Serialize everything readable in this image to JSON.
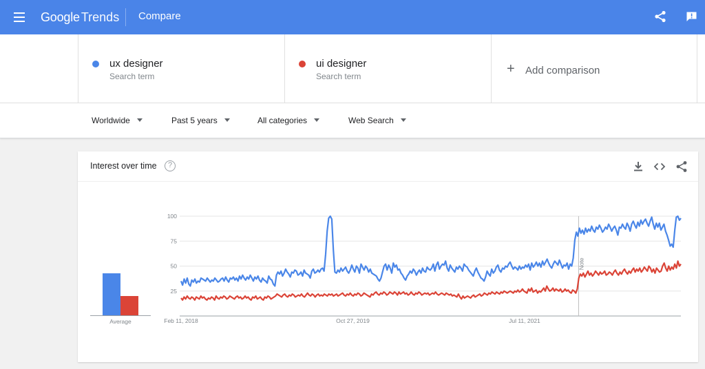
{
  "header": {
    "logo_google": "Google",
    "logo_trends": "Trends",
    "title": "Compare",
    "menu_icon": "hamburger-menu-icon",
    "share_icon": "share-icon",
    "feedback_icon": "feedback-icon"
  },
  "terms": [
    {
      "name": "ux designer",
      "sub": "Search term",
      "color": "#4a86e8"
    },
    {
      "name": "ui designer",
      "sub": "Search term",
      "color": "#db4437"
    }
  ],
  "add_comparison": {
    "icon": "+",
    "label": "Add comparison"
  },
  "filters": [
    "Worldwide",
    "Past 5 years",
    "All categories",
    "Web Search"
  ],
  "card": {
    "title": "Interest over time",
    "help_icon": "?",
    "average_label": "Average",
    "note_label": "Note"
  },
  "colors": {
    "header": "#4a84e8",
    "series_ux": "#4a86e8",
    "series_ui": "#db4437"
  },
  "chart_data": {
    "type": "line",
    "ylim": [
      0,
      100
    ],
    "y_ticks": [
      25,
      50,
      75,
      100
    ],
    "x_tick_labels": [
      "Feb 11, 2018",
      "Oct 27, 2019",
      "Jul 11, 2021"
    ],
    "x_start": "2018-02-11",
    "x_end": "2023-01-29",
    "note_date": "2022-01-23",
    "averages": {
      "ux designer": 53,
      "ui designer": 24
    },
    "series": [
      {
        "name": "ux designer",
        "color": "#4a86e8",
        "values": [
          35,
          31,
          37,
          33,
          38,
          32,
          30,
          36,
          34,
          37,
          33,
          35,
          34,
          38,
          37,
          36,
          35,
          38,
          36,
          34,
          36,
          35,
          38,
          36,
          34,
          35,
          37,
          38,
          35,
          39,
          36,
          34,
          38,
          37,
          39,
          36,
          38,
          35,
          40,
          37,
          41,
          38,
          36,
          39,
          37,
          41,
          38,
          35,
          39,
          37,
          40,
          36,
          34,
          38,
          36,
          35,
          33,
          40,
          37,
          36,
          32,
          30,
          41,
          44,
          42,
          45,
          40,
          43,
          47,
          44,
          42,
          39,
          44,
          43,
          46,
          45,
          41,
          42,
          44,
          40,
          46,
          43,
          42,
          41,
          38,
          45,
          47,
          43,
          44,
          46,
          44,
          47,
          48,
          45,
          62,
          85,
          98,
          100,
          97,
          66,
          44,
          43,
          46,
          44,
          48,
          45,
          47,
          49,
          45,
          43,
          46,
          51,
          47,
          44,
          50,
          48,
          43,
          52,
          49,
          46,
          50,
          48,
          44,
          47,
          43,
          42,
          41,
          40,
          37,
          35,
          38,
          44,
          50,
          52,
          46,
          51,
          48,
          43,
          53,
          49,
          51,
          46,
          47,
          43,
          41,
          38,
          36,
          40,
          42,
          45,
          43,
          47,
          45,
          41,
          44,
          46,
          43,
          48,
          45,
          44,
          49,
          47,
          46,
          48,
          52,
          45,
          51,
          54,
          47,
          50,
          52,
          51,
          55,
          48,
          45,
          51,
          48,
          46,
          44,
          49,
          47,
          50,
          48,
          45,
          52,
          50,
          49,
          46,
          44,
          42,
          40,
          45,
          48,
          44,
          41,
          38,
          37,
          35,
          39,
          45,
          42,
          40,
          47,
          43,
          45,
          49,
          51,
          46,
          44,
          48,
          47,
          50,
          49,
          52,
          54,
          50,
          47,
          49,
          48,
          46,
          50,
          47,
          49,
          48,
          51,
          49,
          52,
          46,
          53,
          49,
          51,
          54,
          50,
          53,
          49,
          55,
          51,
          54,
          57,
          53,
          50,
          48,
          52,
          55,
          53,
          51,
          56,
          52,
          48,
          51,
          50,
          53,
          47,
          52,
          50,
          58,
          76,
          84,
          80,
          88,
          83,
          86,
          82,
          88,
          84,
          87,
          85,
          90,
          86,
          84,
          89,
          87,
          91,
          88,
          84,
          86,
          89,
          87,
          92,
          89,
          85,
          88,
          90,
          86,
          81,
          89,
          88,
          92,
          89,
          87,
          93,
          90,
          85,
          92,
          95,
          91,
          88,
          94,
          90,
          96,
          92,
          95,
          97,
          93,
          90,
          95,
          99,
          92,
          87,
          93,
          89,
          93,
          86,
          89,
          92,
          85,
          81,
          76,
          70,
          72,
          69,
          86,
          99,
          100,
          96,
          98
        ]
      },
      {
        "name": "ui designer",
        "color": "#db4437",
        "values": [
          18,
          16,
          19,
          17,
          20,
          18,
          17,
          19,
          18,
          16,
          19,
          18,
          17,
          20,
          18,
          19,
          17,
          16,
          18,
          17,
          19,
          18,
          16,
          20,
          18,
          17,
          19,
          18,
          20,
          19,
          17,
          18,
          20,
          19,
          18,
          17,
          19,
          20,
          18,
          19,
          17,
          18,
          20,
          18,
          19,
          17,
          16,
          19,
          18,
          20,
          17,
          18,
          19,
          17,
          16,
          19,
          18,
          20,
          19,
          17,
          18,
          19,
          20,
          22,
          21,
          20,
          19,
          21,
          22,
          20,
          19,
          21,
          20,
          22,
          21,
          19,
          20,
          21,
          20,
          22,
          20,
          19,
          21,
          23,
          21,
          20,
          22,
          21,
          19,
          21,
          22,
          20,
          21,
          20,
          22,
          21,
          20,
          22,
          21,
          22,
          20,
          21,
          22,
          20,
          21,
          22,
          23,
          21,
          20,
          22,
          21,
          23,
          21,
          20,
          22,
          21,
          23,
          22,
          20,
          21,
          23,
          22,
          21,
          20,
          19,
          22,
          21,
          23,
          24,
          22,
          21,
          23,
          22,
          24,
          23,
          21,
          22,
          24,
          23,
          22,
          24,
          23,
          21,
          24,
          22,
          23,
          24,
          22,
          23,
          21,
          22,
          24,
          22,
          21,
          23,
          22,
          24,
          23,
          21,
          22,
          23,
          22,
          23,
          21,
          22,
          23,
          22,
          24,
          22,
          21,
          22,
          23,
          22,
          21,
          23,
          22,
          21,
          22,
          20,
          21,
          20,
          19,
          22,
          19,
          17,
          20,
          18,
          19,
          20,
          19,
          18,
          20,
          21,
          19,
          20,
          21,
          22,
          20,
          21,
          23,
          22,
          21,
          23,
          22,
          24,
          23,
          22,
          24,
          23,
          22,
          24,
          23,
          25,
          24,
          23,
          24,
          25,
          24,
          23,
          25,
          24,
          26,
          24,
          25,
          27,
          25,
          24,
          23,
          27,
          25,
          28,
          24,
          25,
          26,
          23,
          25,
          24,
          26,
          28,
          25,
          30,
          27,
          25,
          26,
          28,
          25,
          27,
          26,
          25,
          27,
          24,
          25,
          27,
          25,
          26,
          24,
          23,
          26,
          25,
          23,
          27,
          38,
          42,
          40,
          43,
          39,
          42,
          45,
          41,
          43,
          40,
          42,
          45,
          43,
          41,
          44,
          42,
          43,
          45,
          41,
          42,
          44,
          43,
          41,
          44,
          46,
          43,
          41,
          44,
          42,
          45,
          47,
          44,
          42,
          45,
          43,
          46,
          48,
          44,
          47,
          45,
          48,
          44,
          46,
          49,
          47,
          45,
          50,
          48,
          44,
          47,
          43,
          48,
          46,
          44,
          45,
          50,
          53,
          48,
          45,
          50,
          46,
          49,
          47,
          52,
          48,
          55,
          50,
          52
        ]
      }
    ]
  }
}
